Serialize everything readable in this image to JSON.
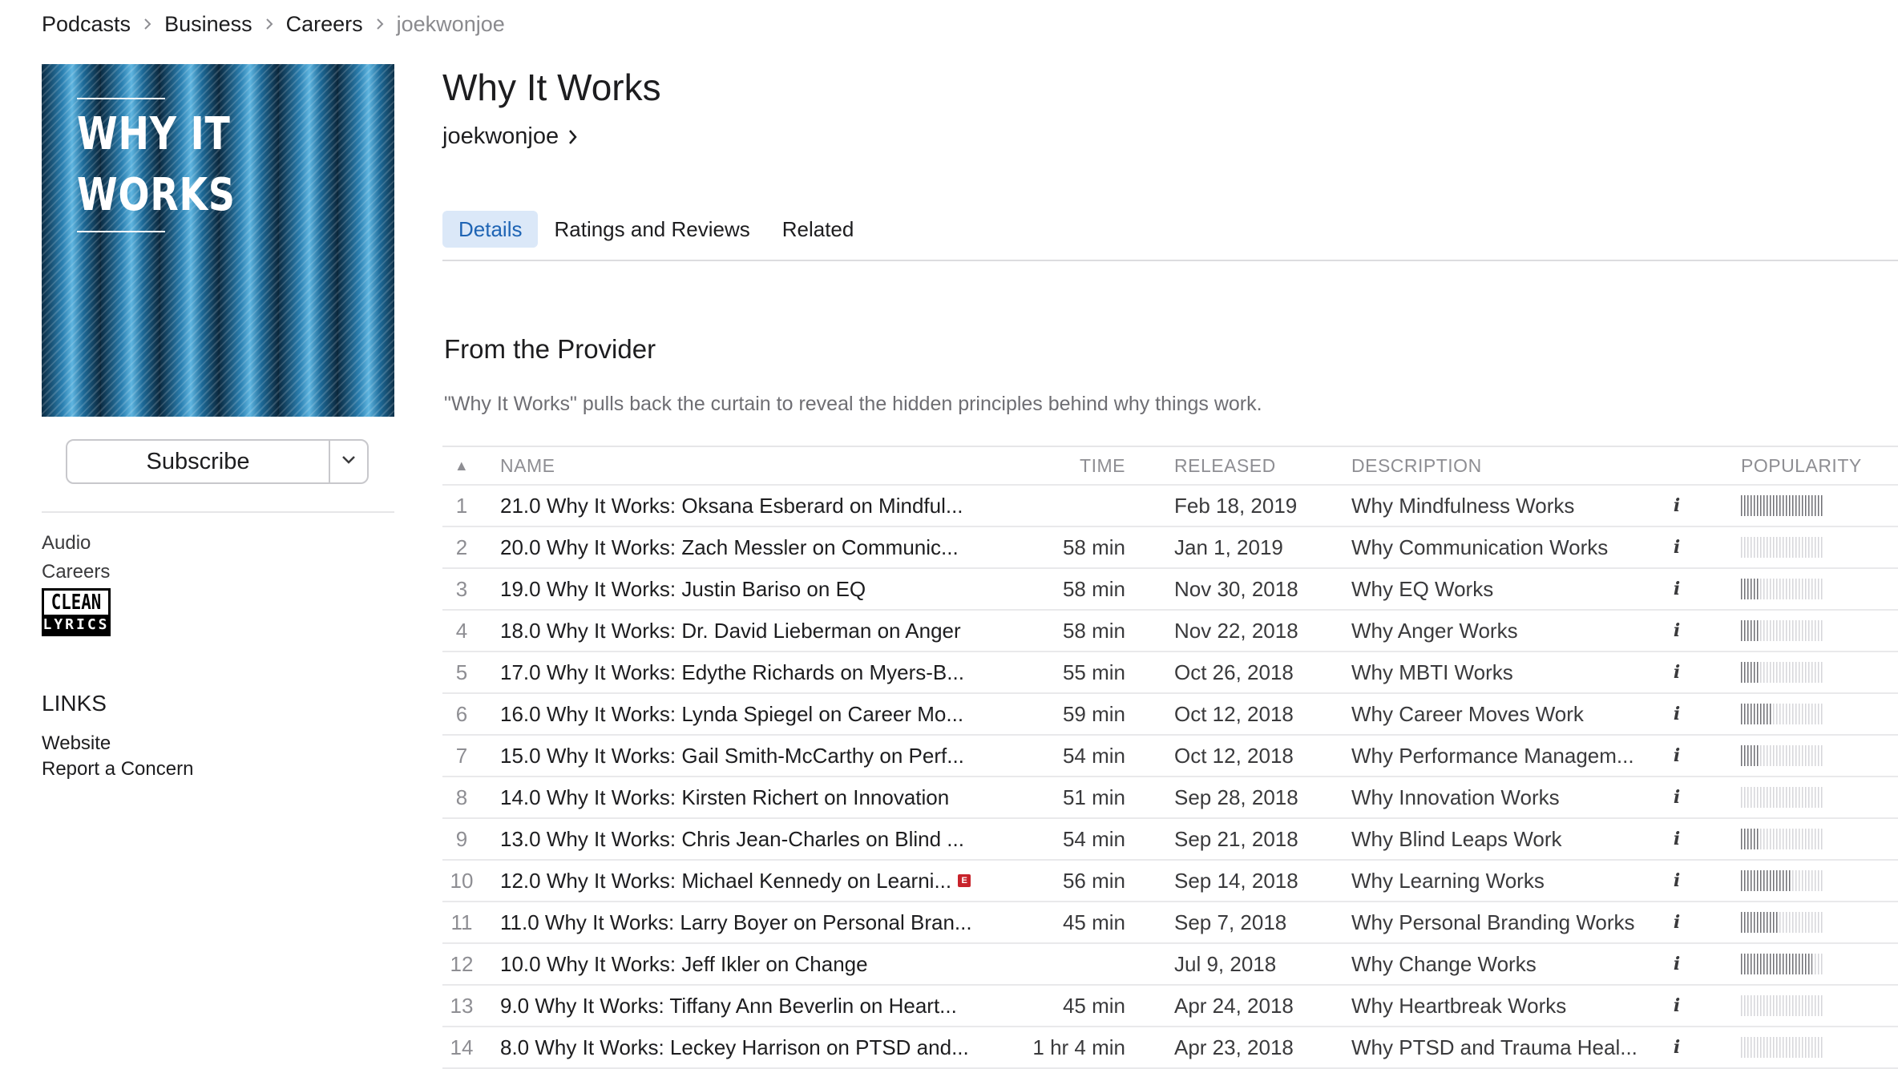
{
  "breadcrumb": [
    {
      "label": "Podcasts"
    },
    {
      "label": "Business"
    },
    {
      "label": "Careers"
    },
    {
      "label": "joekwonjoe",
      "current": true
    }
  ],
  "cover": {
    "line1": "WHY IT",
    "line2": "WORKS"
  },
  "subscribe": {
    "label": "Subscribe",
    "dropdown_icon": "chevron-down-icon"
  },
  "meta": {
    "type": "Audio",
    "category": "Careers",
    "badge_top": "CLEAN",
    "badge_bottom": "LYRICS"
  },
  "links": {
    "heading": "LINKS",
    "website": "Website",
    "report": "Report a Concern"
  },
  "podcast": {
    "title": "Why It Works",
    "artist": "joekwonjoe"
  },
  "tabs": [
    {
      "label": "Details",
      "active": true
    },
    {
      "label": "Ratings and Reviews",
      "active": false
    },
    {
      "label": "Related",
      "active": false
    }
  ],
  "section": {
    "title": "From the Provider",
    "description": "\"Why It Works\" pulls back the curtain to reveal the hidden principles behind why things work."
  },
  "table": {
    "headers": {
      "sort": "▲",
      "name": "NAME",
      "time": "TIME",
      "released": "RELEASED",
      "description": "DESCRIPTION",
      "popularity": "POPULARITY"
    },
    "info_label": "i",
    "explicit_label": "E",
    "rows": [
      {
        "num": "1",
        "name": "21.0 Why It Works: Oksana Esberard on Mindful...",
        "time": "",
        "released": "Feb 18, 2019",
        "description": "Why Mindfulness Works",
        "popularity": 1.0,
        "explicit": false
      },
      {
        "num": "2",
        "name": "20.0 Why It Works: Zach Messler on Communic...",
        "time": "58 min",
        "released": "Jan 1, 2019",
        "description": "Why Communication Works",
        "popularity": 0.0,
        "explicit": false
      },
      {
        "num": "3",
        "name": "19.0 Why It Works: Justin Bariso on EQ",
        "time": "58 min",
        "released": "Nov 30, 2018",
        "description": "Why EQ Works",
        "popularity": 0.22,
        "explicit": false
      },
      {
        "num": "4",
        "name": "18.0 Why It Works: Dr. David Lieberman on Anger",
        "time": "58 min",
        "released": "Nov 22, 2018",
        "description": "Why Anger Works",
        "popularity": 0.22,
        "explicit": false
      },
      {
        "num": "5",
        "name": "17.0 Why It Works: Edythe Richards on Myers-B...",
        "time": "55 min",
        "released": "Oct 26, 2018",
        "description": "Why MBTI Works",
        "popularity": 0.22,
        "explicit": false
      },
      {
        "num": "6",
        "name": "16.0 Why It Works: Lynda Spiegel on Career Mo...",
        "time": "59 min",
        "released": "Oct 12, 2018",
        "description": "Why Career Moves Work",
        "popularity": 0.38,
        "explicit": false
      },
      {
        "num": "7",
        "name": "15.0 Why It Works: Gail Smith-McCarthy on Perf...",
        "time": "54 min",
        "released": "Oct 12, 2018",
        "description": "Why Performance Managem...",
        "popularity": 0.22,
        "explicit": false
      },
      {
        "num": "8",
        "name": "14.0 Why It Works: Kirsten Richert on Innovation",
        "time": "51 min",
        "released": "Sep 28, 2018",
        "description": "Why Innovation Works",
        "popularity": 0.0,
        "explicit": false
      },
      {
        "num": "9",
        "name": "13.0 Why It Works: Chris Jean-Charles on Blind ...",
        "time": "54 min",
        "released": "Sep 21, 2018",
        "description": "Why Blind Leaps Work",
        "popularity": 0.22,
        "explicit": false
      },
      {
        "num": "10",
        "name": "12.0 Why It Works: Michael Kennedy on Learni...",
        "time": "56 min",
        "released": "Sep 14, 2018",
        "description": "Why Learning Works",
        "popularity": 0.6,
        "explicit": true
      },
      {
        "num": "11",
        "name": "11.0 Why It Works: Larry Boyer on Personal Bran...",
        "time": "45 min",
        "released": "Sep 7, 2018",
        "description": "Why Personal Branding Works",
        "popularity": 0.46,
        "explicit": false
      },
      {
        "num": "12",
        "name": "10.0 Why It Works: Jeff Ikler on Change",
        "time": "",
        "released": "Jul 9, 2018",
        "description": "Why Change Works",
        "popularity": 0.86,
        "explicit": false
      },
      {
        "num": "13",
        "name": "9.0 Why It Works: Tiffany Ann Beverlin on Heart...",
        "time": "45 min",
        "released": "Apr 24, 2018",
        "description": "Why Heartbreak Works",
        "popularity": 0.0,
        "explicit": false
      },
      {
        "num": "14",
        "name": "8.0 Why It Works: Leckey Harrison on PTSD and...",
        "time": "1 hr 4 min",
        "released": "Apr 23, 2018",
        "description": "Why PTSD and Trauma Heal...",
        "popularity": 0.0,
        "explicit": false
      }
    ]
  }
}
